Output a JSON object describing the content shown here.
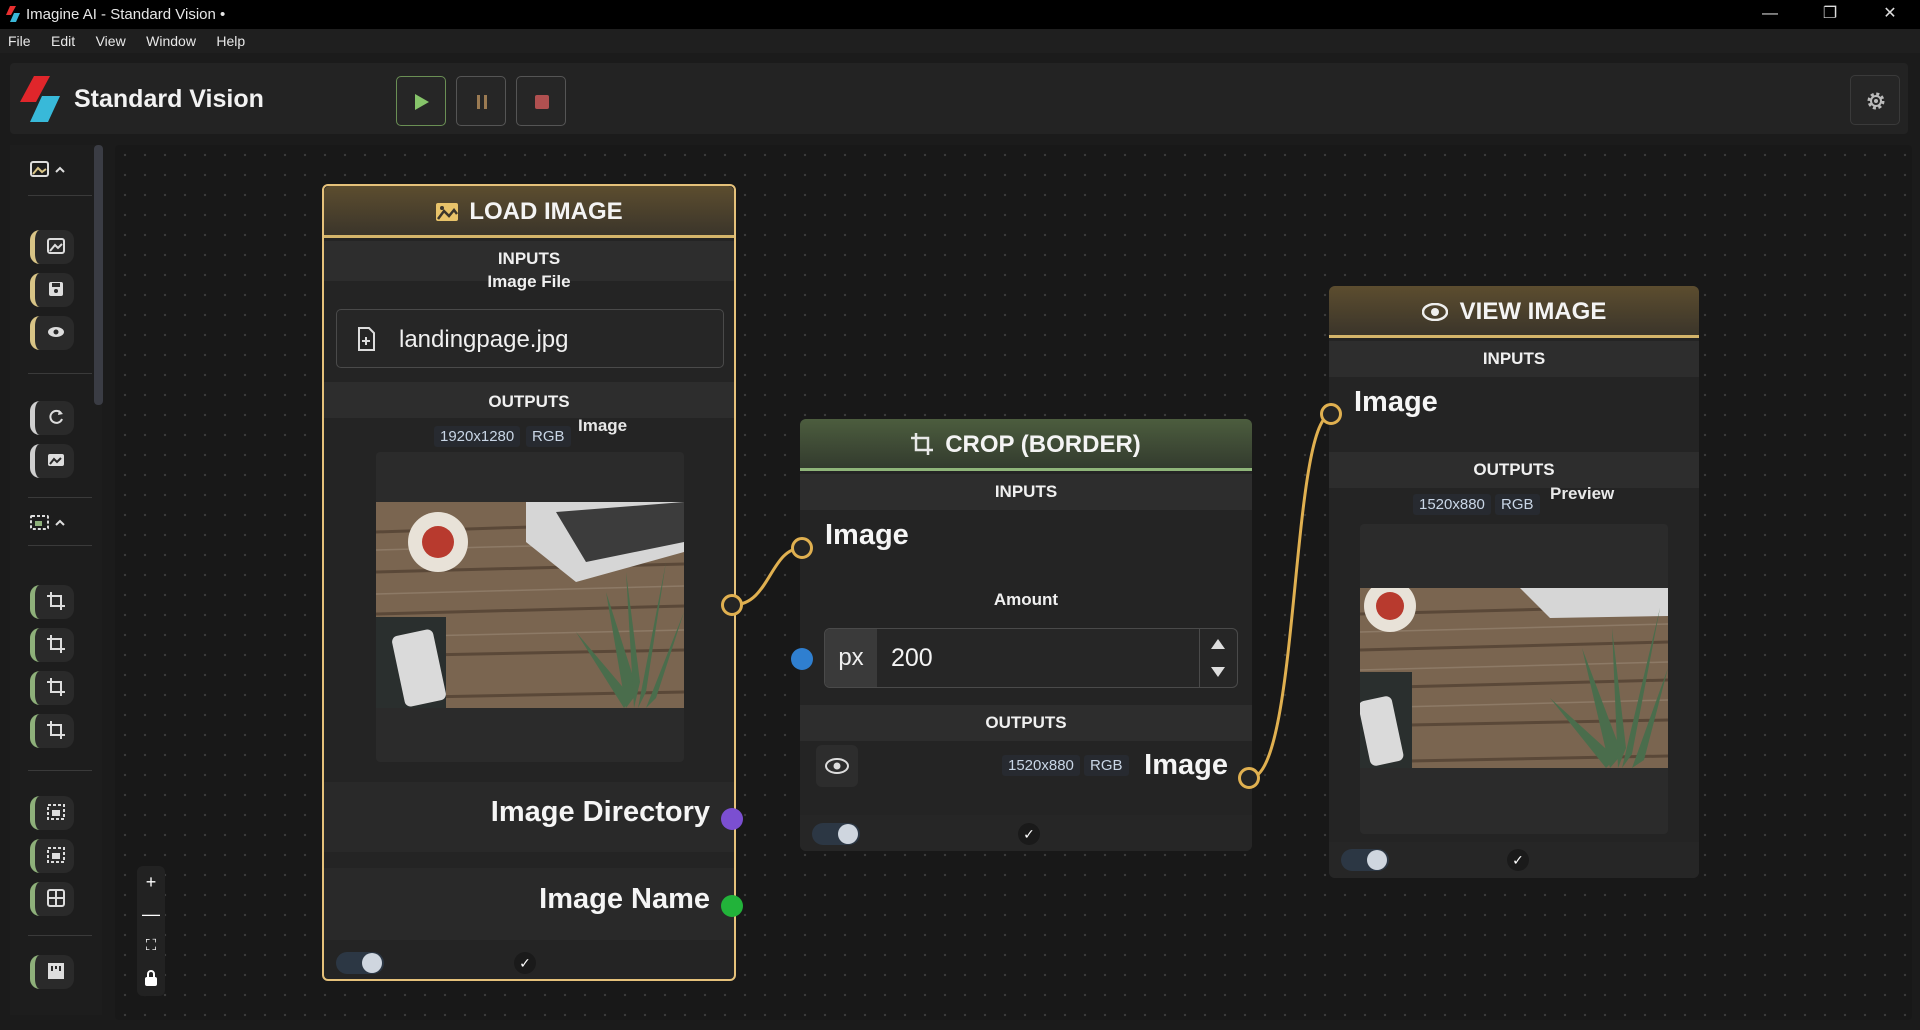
{
  "window": {
    "title": "Imagine AI - Standard Vision •",
    "minimize_glyph": "—",
    "restore_glyph": "❐",
    "close_glyph": "✕"
  },
  "menu": [
    "File",
    "Edit",
    "View",
    "Window",
    "Help"
  ],
  "header": {
    "brand": "Standard Vision",
    "controls": [
      "play-icon",
      "pause-icon",
      "stop-icon"
    ],
    "settings_icon": "gear-icon"
  },
  "sidebar": {
    "groups": [
      {
        "icon": "image-group-icon",
        "items": [
          "image-icon",
          "save-icon",
          "eye-icon"
        ]
      },
      {
        "icon": "edit-group-icon",
        "items": [
          "rotate-icon",
          "camera-icon"
        ]
      },
      {
        "icon": "crop-group-icon",
        "items": [
          "crop-icon",
          "crop-icon",
          "crop-icon",
          "crop-icon"
        ]
      },
      {
        "icon": "layout-group-icon",
        "items": [
          "image-frame-icon",
          "image-frame-icon",
          "grid-icon",
          "ruler-icon"
        ]
      }
    ]
  },
  "zoom": {
    "in": "+",
    "out": "—",
    "fit": "⛶",
    "lock": "🔒"
  },
  "nodes": {
    "load_image": {
      "title": "LOAD IMAGE",
      "inputs_label": "INPUTS",
      "image_file_label": "Image File",
      "file_name": "landingpage.jpg",
      "outputs_label": "OUTPUTS",
      "resolution": "1920x1280",
      "color_mode": "RGB",
      "image_output_label": "Image",
      "directory_label": "Image Directory",
      "name_label": "Image Name",
      "done_glyph": "✓"
    },
    "crop_border": {
      "title": "CROP (BORDER)",
      "inputs_label": "INPUTS",
      "image_input_label": "Image",
      "amount_label": "Amount",
      "amount_unit": "px",
      "amount_value": "200",
      "outputs_label": "OUTPUTS",
      "resolution": "1520x880",
      "color_mode": "RGB",
      "image_output_label": "Image",
      "done_glyph": "✓"
    },
    "view_image": {
      "title": "VIEW IMAGE",
      "inputs_label": "INPUTS",
      "image_input_label": "Image",
      "outputs_label": "OUTPUTS",
      "resolution": "1520x880",
      "color_mode": "RGB",
      "preview_label": "Preview",
      "done_glyph": "✓"
    }
  },
  "colors": {
    "accent_gold": "#e5c17a",
    "accent_green": "#8fb57a",
    "handle_image": "#e0b050",
    "handle_directory": "#7b4fd1",
    "handle_name": "#22b33a",
    "handle_amount": "#2f7fd0"
  }
}
